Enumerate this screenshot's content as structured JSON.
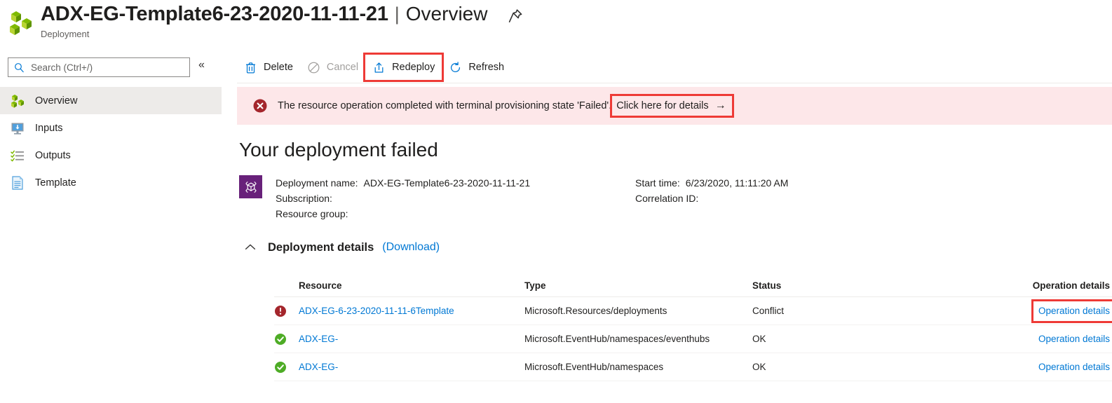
{
  "header": {
    "title": "ADX-EG-Template6-23-2020-11-11-21",
    "separator": "|",
    "view": "Overview",
    "subtitle": "Deployment",
    "resource_icon": "deployment-cubes-icon",
    "pin_icon": "pin-icon"
  },
  "sidebar": {
    "search": {
      "placeholder": "Search (Ctrl+/)",
      "value": "",
      "icon": "search-icon"
    },
    "collapse_icon": "chevron-double-left-icon",
    "items": [
      {
        "label": "Overview",
        "icon": "overview-cubes-icon",
        "selected": true
      },
      {
        "label": "Inputs",
        "icon": "inputs-monitor-download-icon",
        "selected": false
      },
      {
        "label": "Outputs",
        "icon": "outputs-checklist-icon",
        "selected": false
      },
      {
        "label": "Template",
        "icon": "template-document-icon",
        "selected": false
      }
    ]
  },
  "commandbar": {
    "commands": [
      {
        "label": "Delete",
        "icon": "trash-icon",
        "disabled": false,
        "highlighted": false
      },
      {
        "label": "Cancel",
        "icon": "cancel-circle-slash-icon",
        "disabled": true,
        "highlighted": false
      },
      {
        "label": "Redeploy",
        "icon": "upload-box-arrow-up-icon",
        "disabled": false,
        "highlighted": true
      },
      {
        "label": "Refresh",
        "icon": "refresh-circular-arrow-icon",
        "disabled": false,
        "highlighted": false
      }
    ]
  },
  "banner": {
    "icon": "error-x-circle-icon",
    "message": "The resource operation completed with terminal provisioning state 'Failed'.",
    "link_label": "Click here for details",
    "link_arrow": "→",
    "highlighted": true,
    "background_color": "#fde7e9",
    "icon_color": "#a4262c"
  },
  "main": {
    "heading": "Your deployment failed",
    "deployment_icon": "deployment-template-box-icon",
    "deployment_icon_color": "#68217a",
    "info_left": [
      {
        "key": "Deployment name:",
        "value": "ADX-EG-Template6-23-2020-11-11-21"
      },
      {
        "key": "Subscription:",
        "value": ""
      },
      {
        "key": "Resource group:",
        "value": ""
      }
    ],
    "info_right": [
      {
        "key": "Start time:",
        "value": "6/23/2020, 11:11:20 AM"
      },
      {
        "key": "Correlation ID:",
        "value": ""
      }
    ],
    "details_section": {
      "collapse_icon": "chevron-up-icon",
      "title": "Deployment details",
      "download_label": "(Download)"
    },
    "table": {
      "columns": [
        "Resource",
        "Type",
        "Status",
        "Operation details"
      ],
      "rows": [
        {
          "status_icon": "error-exclamation-circle-icon",
          "status_icon_color": "#a4262c",
          "resource": "ADX-EG-6-23-2020-11-11-6Template",
          "type": "Microsoft.Resources/deployments",
          "status": "Conflict",
          "operation_details": "Operation details",
          "highlighted": true
        },
        {
          "status_icon": "success-check-circle-icon",
          "status_icon_color": "#4eac26",
          "resource": "ADX-EG-",
          "type": "Microsoft.EventHub/namespaces/eventhubs",
          "status": "OK",
          "operation_details": "Operation details",
          "highlighted": false
        },
        {
          "status_icon": "success-check-circle-icon",
          "status_icon_color": "#4eac26",
          "resource": "ADX-EG-",
          "type": "Microsoft.EventHub/namespaces",
          "status": "OK",
          "operation_details": "Operation details",
          "highlighted": false
        }
      ]
    }
  },
  "colors": {
    "accent": "#0078d4",
    "error": "#a4262c",
    "success": "#4eac26",
    "highlight_outline": "#ee3a36",
    "purple": "#68217a"
  }
}
